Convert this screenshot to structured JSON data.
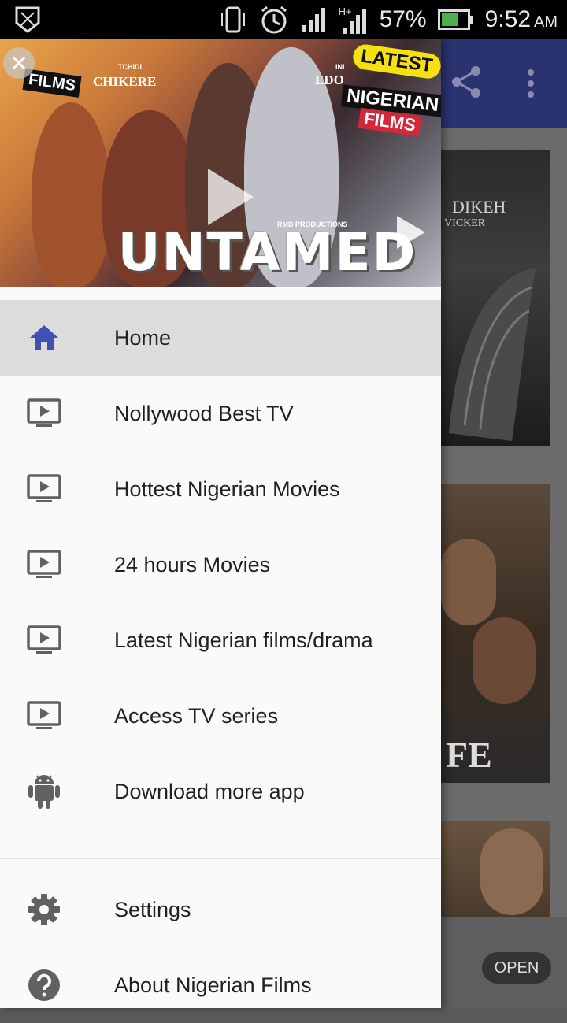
{
  "status_bar": {
    "battery": "57%",
    "time": "9:52",
    "ampm": "AM",
    "network": "H+"
  },
  "banner": {
    "title": "UNTAMED",
    "labels": [
      "FILMS",
      "TCHIDI",
      "CHIKERE",
      "INI",
      "EDO",
      "LATEST",
      "NIGERIAN",
      "FILMS",
      "RMD PRODUCTIONS"
    ]
  },
  "menu": {
    "items": [
      {
        "label": "Home",
        "icon": "home-icon"
      },
      {
        "label": "Nollywood Best TV",
        "icon": "tv-play-icon"
      },
      {
        "label": "Hottest Nigerian Movies",
        "icon": "tv-play-icon"
      },
      {
        "label": "24 hours Movies",
        "icon": "tv-play-icon"
      },
      {
        "label": "Latest Nigerian films/drama",
        "icon": "tv-play-icon"
      },
      {
        "label": "Access TV series",
        "icon": "tv-play-icon"
      },
      {
        "label": "Download more app",
        "icon": "android-icon"
      }
    ],
    "lower_items": [
      {
        "label": "Settings",
        "icon": "gear-icon"
      },
      {
        "label": "About Nigerian Films",
        "icon": "help-icon"
      }
    ]
  },
  "background": {
    "card1_text": "DIKEH",
    "card1_sub": "VICKER",
    "card2_text": "FE",
    "open_button": "OPEN"
  },
  "colors": {
    "accent": "#3f51b5",
    "appbar": "#2a3370",
    "icon_gray": "#616161"
  }
}
